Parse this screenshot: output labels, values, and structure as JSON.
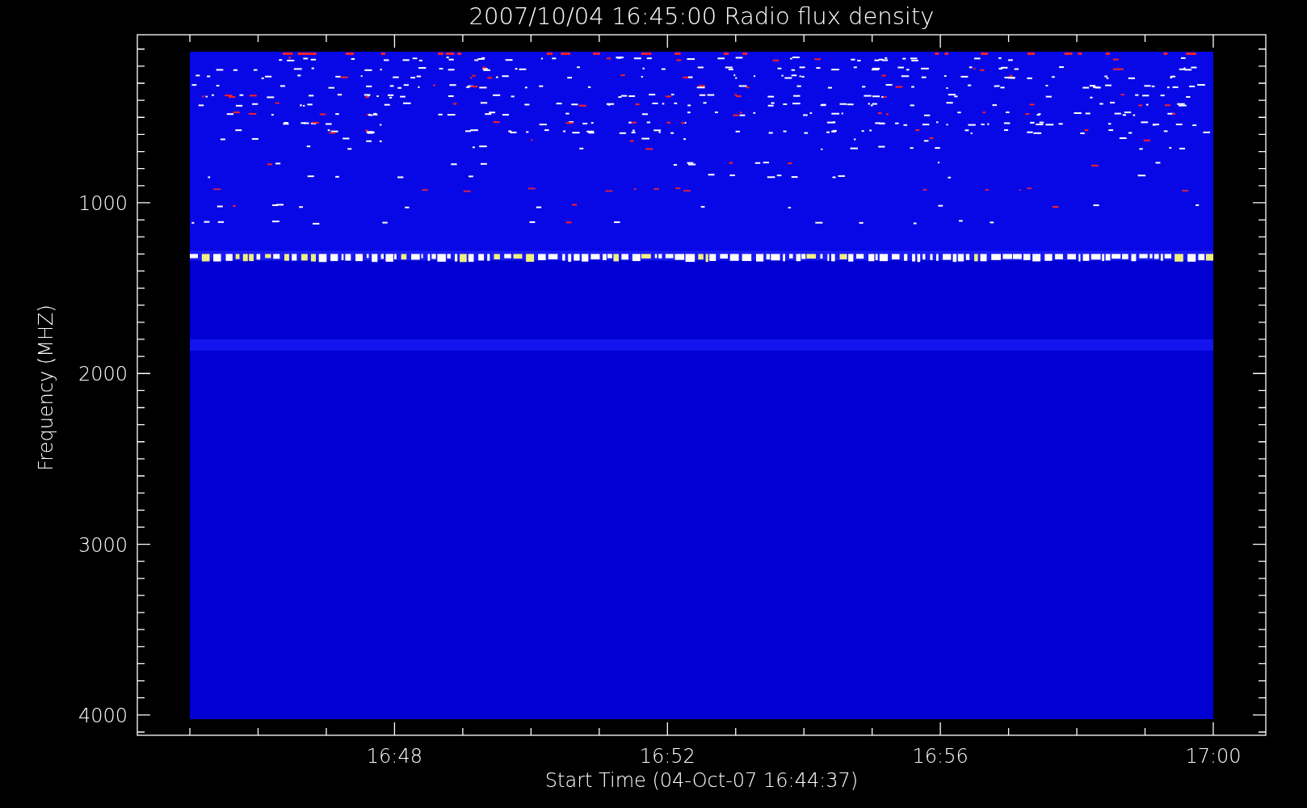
{
  "plot": {
    "title": "2007/10/04 16:45:00 Radio flux density",
    "xlabel": "Start Time (04-Oct-07 16:44:37)",
    "ylabel": "Frequency (MHZ)",
    "yticks": [
      "1000",
      "2000",
      "3000",
      "4000"
    ],
    "xticks": [
      "16:48",
      "16:52",
      "16:56",
      "17:00"
    ]
  }
}
